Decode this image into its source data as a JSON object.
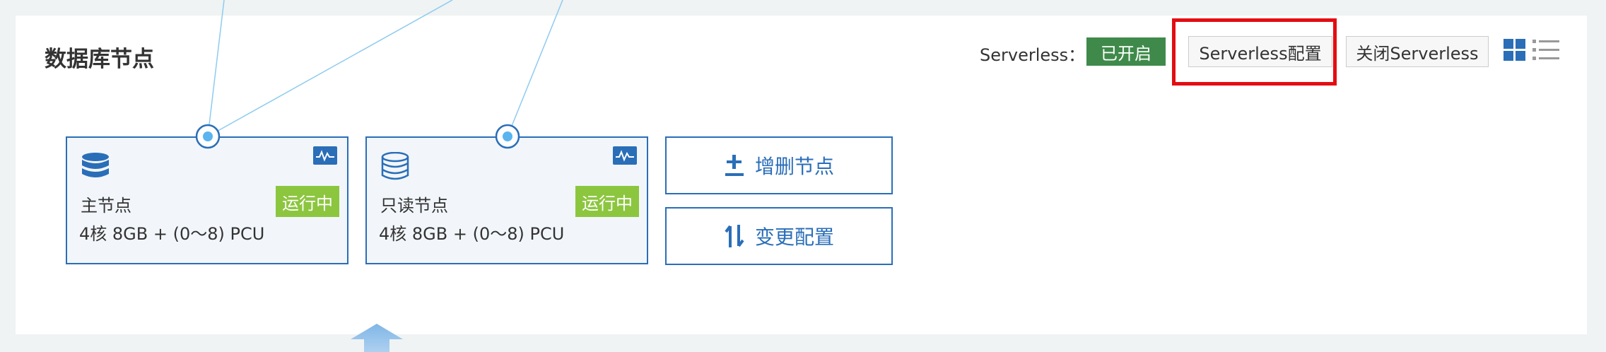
{
  "colors": {
    "accent": "#2a6eb8",
    "enabled_badge": "#3f8a4a",
    "running_badge": "#8cc63f",
    "highlight": "#e30d12"
  },
  "section": {
    "title": "数据库节点"
  },
  "serverless": {
    "label": "Serverless：",
    "status": "已开启",
    "config_button": "Serverless配置",
    "close_button": "关闭Serverless"
  },
  "view_toggle": {
    "grid_icon": "grid-view-icon",
    "list_icon": "list-view-icon"
  },
  "nodes": [
    {
      "name": "主节点",
      "spec": "4核 8GB + (0～8) PCU",
      "status": "运行中",
      "icon": "database-filled-icon"
    },
    {
      "name": "只读节点",
      "spec": "4核 8GB + (0～8) PCU",
      "status": "运行中",
      "icon": "database-outline-icon"
    }
  ],
  "actions": {
    "add_remove": {
      "label": "增删节点",
      "icon": "plus-minus-icon"
    },
    "change_config": {
      "label": "变更配置",
      "icon": "swap-vertical-icon"
    }
  }
}
